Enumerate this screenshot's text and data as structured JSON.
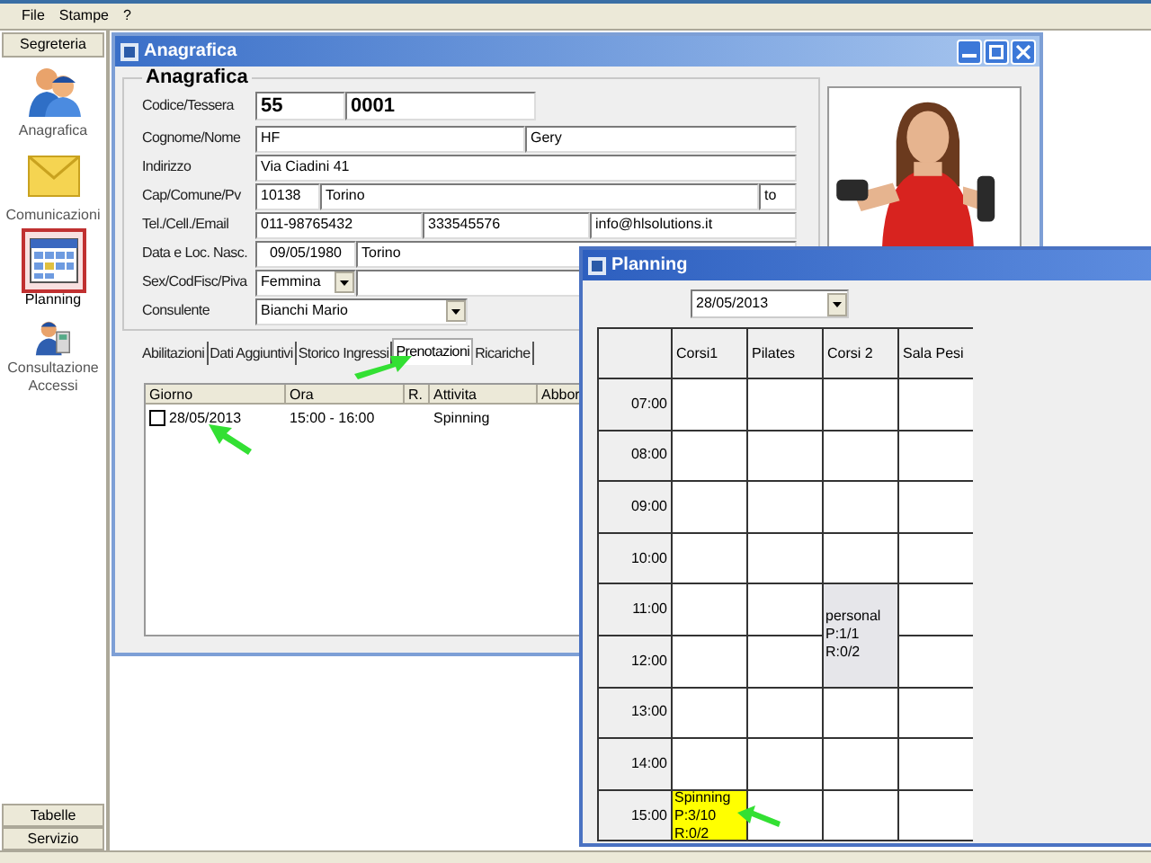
{
  "menu": [
    {
      "label": "File"
    },
    {
      "label": "Stampe"
    },
    {
      "label": "?"
    }
  ],
  "sidebar": {
    "header": "Segreteria",
    "items": [
      {
        "label": "Anagrafica",
        "selected": false
      },
      {
        "label": "Comunicazioni",
        "selected": false
      },
      {
        "label": "Planning",
        "selected": true
      },
      {
        "label": "Consultazione Accessi",
        "selected": false
      }
    ],
    "footer": [
      "Tabelle",
      "Servizio"
    ]
  },
  "anagrafica": {
    "title": "Anagrafica",
    "group": "Anagrafica",
    "fields": [
      {
        "label": "Codice/Tessera",
        "inputs": [
          {
            "kind": "code",
            "value": "55"
          },
          {
            "kind": "code",
            "value": "0001"
          }
        ]
      },
      {
        "label": "Cognome/Nome",
        "inputs": [
          {
            "kind": "text",
            "value": "HF"
          },
          {
            "kind": "text",
            "value": "Gery"
          }
        ]
      },
      {
        "label": "Indirizzo",
        "inputs": [
          {
            "kind": "text",
            "value": "Via Ciadini 41"
          }
        ]
      },
      {
        "label": "Cap/Comune/Pv",
        "inputs": [
          {
            "kind": "text",
            "value": "10138"
          },
          {
            "kind": "text",
            "value": "Torino"
          },
          {
            "kind": "text",
            "value": "to"
          }
        ]
      },
      {
        "label": "Tel./Cell./Email",
        "inputs": [
          {
            "kind": "text",
            "value": "011-98765432"
          },
          {
            "kind": "text",
            "value": "333545576"
          },
          {
            "kind": "text",
            "value": "info@hlsolutions.it"
          }
        ]
      },
      {
        "label": "Data e Loc. Nasc.",
        "inputs": [
          {
            "kind": "date",
            "value": "09/05/1980"
          },
          {
            "kind": "text",
            "value": "Torino"
          }
        ]
      },
      {
        "label": "Sex/CodFisc/Piva",
        "inputs": [
          {
            "kind": "combo",
            "value": "Femmina"
          },
          {
            "kind": "text"
          }
        ]
      },
      {
        "label": "Consulente",
        "inputs": [
          {
            "kind": "combo",
            "value": "Bianchi Mario"
          }
        ]
      }
    ],
    "tabs": [
      {
        "label": "Abilitazioni",
        "selected": false
      },
      {
        "label": "Dati Aggiuntivi",
        "selected": false
      },
      {
        "label": "Storico Ingressi",
        "selected": false
      },
      {
        "label": "Prenotazioni",
        "selected": true
      },
      {
        "label": "Ricariche",
        "selected": false
      }
    ],
    "list": {
      "columns": [
        "Giorno",
        "Ora",
        "R.",
        "Attivita",
        "Abbor"
      ],
      "rows": [
        {
          "checked": false,
          "cells": [
            "28/05/2013",
            "15:00 - 16:00",
            null,
            "Spinning",
            null
          ]
        }
      ]
    }
  },
  "planning": {
    "title": "Planning",
    "date": "28/05/2013",
    "columns": [
      "Corsi1",
      "Pilates",
      "Corsi 2",
      "Sala Pesi"
    ],
    "rows": [
      {
        "time": "07:00",
        "cells": [
          {
            "kind": "empty"
          },
          {
            "kind": "empty"
          },
          {
            "kind": "empty"
          },
          {
            "kind": "empty"
          }
        ]
      },
      {
        "time": "08:00",
        "cells": [
          {
            "kind": "empty"
          },
          {
            "kind": "empty"
          },
          {
            "kind": "empty"
          },
          {
            "kind": "empty"
          }
        ]
      },
      {
        "time": "09:00",
        "cells": [
          {
            "kind": "empty"
          },
          {
            "kind": "empty"
          },
          {
            "kind": "empty"
          },
          {
            "kind": "empty"
          }
        ]
      },
      {
        "time": "10:00",
        "cells": [
          {
            "kind": "empty"
          },
          {
            "kind": "empty"
          },
          {
            "kind": "empty"
          },
          {
            "kind": "empty"
          }
        ]
      },
      {
        "time": "11:00",
        "cells": [
          {
            "kind": "empty"
          },
          {
            "kind": "empty"
          },
          {
            "kind": "event",
            "lines": [
              "personal",
              "P:1/1",
              "R:0/2"
            ],
            "color": "#e6e6ea"
          },
          {
            "kind": "empty"
          }
        ]
      },
      {
        "time": "12:00",
        "cells": [
          {
            "kind": "empty"
          },
          {
            "kind": "empty"
          },
          {
            "kind": "continuation"
          },
          {
            "kind": "empty"
          }
        ]
      },
      {
        "time": "13:00",
        "cells": [
          {
            "kind": "empty"
          },
          {
            "kind": "empty"
          },
          {
            "kind": "empty"
          },
          {
            "kind": "empty"
          }
        ]
      },
      {
        "time": "14:00",
        "cells": [
          {
            "kind": "empty"
          },
          {
            "kind": "empty"
          },
          {
            "kind": "empty"
          },
          {
            "kind": "empty"
          }
        ]
      },
      {
        "time": "15:00",
        "cells": [
          {
            "kind": "event",
            "lines": [
              "Spinning",
              "P:3/10",
              "R:0/2"
            ],
            "color": "#ffff00"
          },
          {
            "kind": "empty"
          },
          {
            "kind": "empty"
          },
          {
            "kind": "empty"
          }
        ]
      }
    ]
  }
}
